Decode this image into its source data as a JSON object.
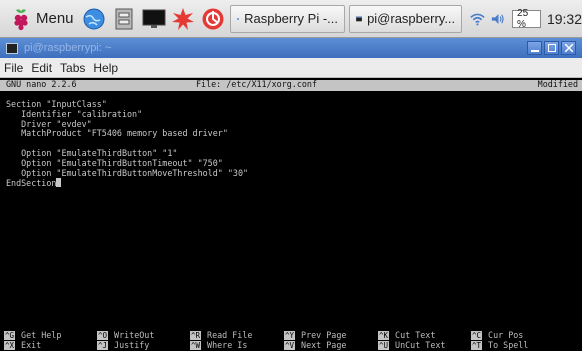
{
  "taskbar": {
    "menu_label": "Menu",
    "tasks": [
      {
        "label": "Raspberry Pi -...",
        "icon": "globe-icon"
      },
      {
        "label": "pi@raspberry...",
        "icon": "terminal-icon"
      }
    ],
    "cpu": "25 %",
    "clock": "19:32"
  },
  "window": {
    "title": "pi@raspberrypi: ~"
  },
  "menubar": [
    "File",
    "Edit",
    "Tabs",
    "Help"
  ],
  "nano": {
    "version": "GNU nano 2.2.6",
    "file": "File: /etc/X11/xorg.conf",
    "status": "Modified"
  },
  "buffer": [
    "Section \"InputClass\"",
    "   Identifier \"calibration\"",
    "   Driver \"evdev\"",
    "   MatchProduct \"FT5406 memory based driver\"",
    "",
    "   Option \"EmulateThirdButton\" \"1\"",
    "   Option \"EmulateThirdButtonTimeout\" \"750\"",
    "   Option \"EmulateThirdButtonMoveThreshold\" \"30\"",
    "EndSection"
  ],
  "shortcuts": [
    {
      "key1": "^G",
      "label1": "Get Help",
      "key2": "^X",
      "label2": "Exit"
    },
    {
      "key1": "^O",
      "label1": "WriteOut",
      "key2": "^J",
      "label2": "Justify"
    },
    {
      "key1": "^R",
      "label1": "Read File",
      "key2": "^W",
      "label2": "Where Is"
    },
    {
      "key1": "^Y",
      "label1": "Prev Page",
      "key2": "^V",
      "label2": "Next Page"
    },
    {
      "key1": "^K",
      "label1": "Cut Text",
      "key2": "^U",
      "label2": "UnCut Text"
    },
    {
      "key1": "^C",
      "label1": "Cur Pos",
      "key2": "^T",
      "label2": "To Spell"
    }
  ],
  "colors": {
    "titlebar": "#4a7ccb",
    "terminal_bg": "#000000",
    "terminal_fg": "#c9c9c9",
    "nano_bar": "#c4c4c4"
  }
}
